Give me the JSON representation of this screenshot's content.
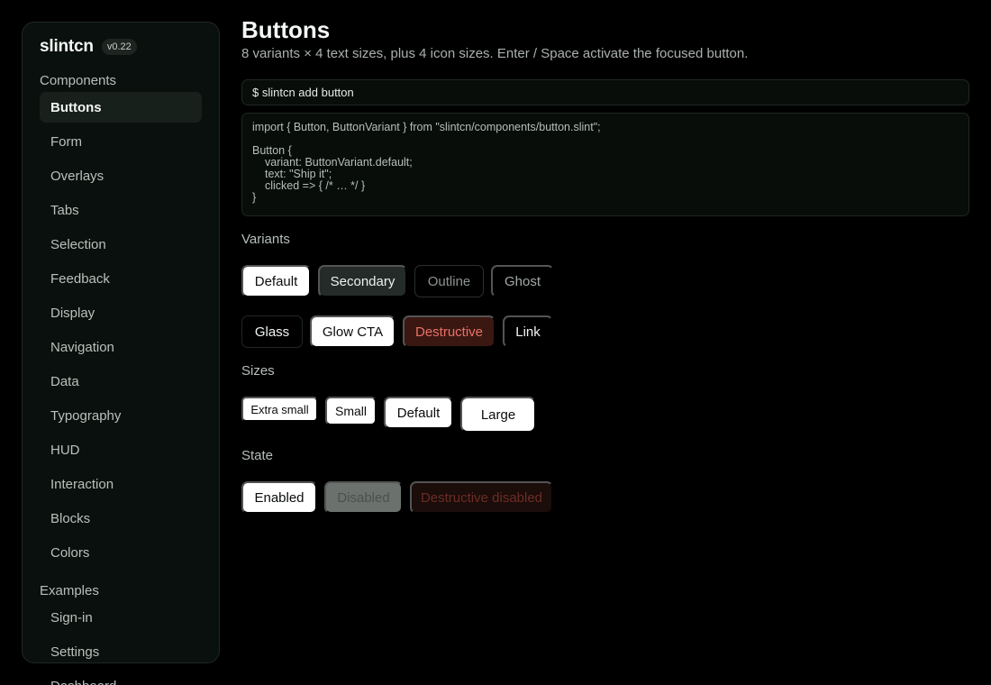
{
  "sidebar": {
    "brand": "slintcn",
    "version": "v0.22",
    "components_title": "Components",
    "components": [
      "Buttons",
      "Form",
      "Overlays",
      "Tabs",
      "Selection",
      "Feedback",
      "Display",
      "Navigation",
      "Data",
      "Typography",
      "HUD",
      "Interaction",
      "Blocks",
      "Colors"
    ],
    "active": "Buttons",
    "examples_title": "Examples",
    "examples": [
      "Sign-in",
      "Settings",
      "Dashboard"
    ]
  },
  "main": {
    "title": "Buttons",
    "description": "8 variants × 4 text sizes, plus 4 icon sizes. Enter / Space activate the focused button.",
    "install_command": "$ slintcn add button",
    "code": {
      "line1": "import { Button, ButtonVariant } from \"slintcn/components/button.slint\";",
      "line2": "Button {",
      "line3": "variant: ButtonVariant.default;",
      "line4": "text: \"Ship it\";",
      "line5": "clicked => { /* … */ }",
      "line6": "}"
    },
    "variants_label": "Variants",
    "variants": {
      "default": "Default",
      "secondary": "Secondary",
      "outline": "Outline",
      "ghost": "Ghost",
      "glass": "Glass",
      "glow_cta": "Glow CTA",
      "destructive": "Destructive",
      "link": "Link"
    },
    "sizes_label": "Sizes",
    "sizes": {
      "extra_small": "Extra small",
      "small": "Small",
      "default": "Default",
      "large": "Large"
    },
    "state_label": "State",
    "states": {
      "enabled": "Enabled",
      "disabled": "Disabled",
      "destructive_disabled": "Destructive disabled"
    }
  },
  "colors": {
    "background": "#000000",
    "sidebar_bg": "#0a100d",
    "primary_button": "#ffffff",
    "destructive_bg": "#3b1712",
    "destructive_text": "#e87267"
  }
}
